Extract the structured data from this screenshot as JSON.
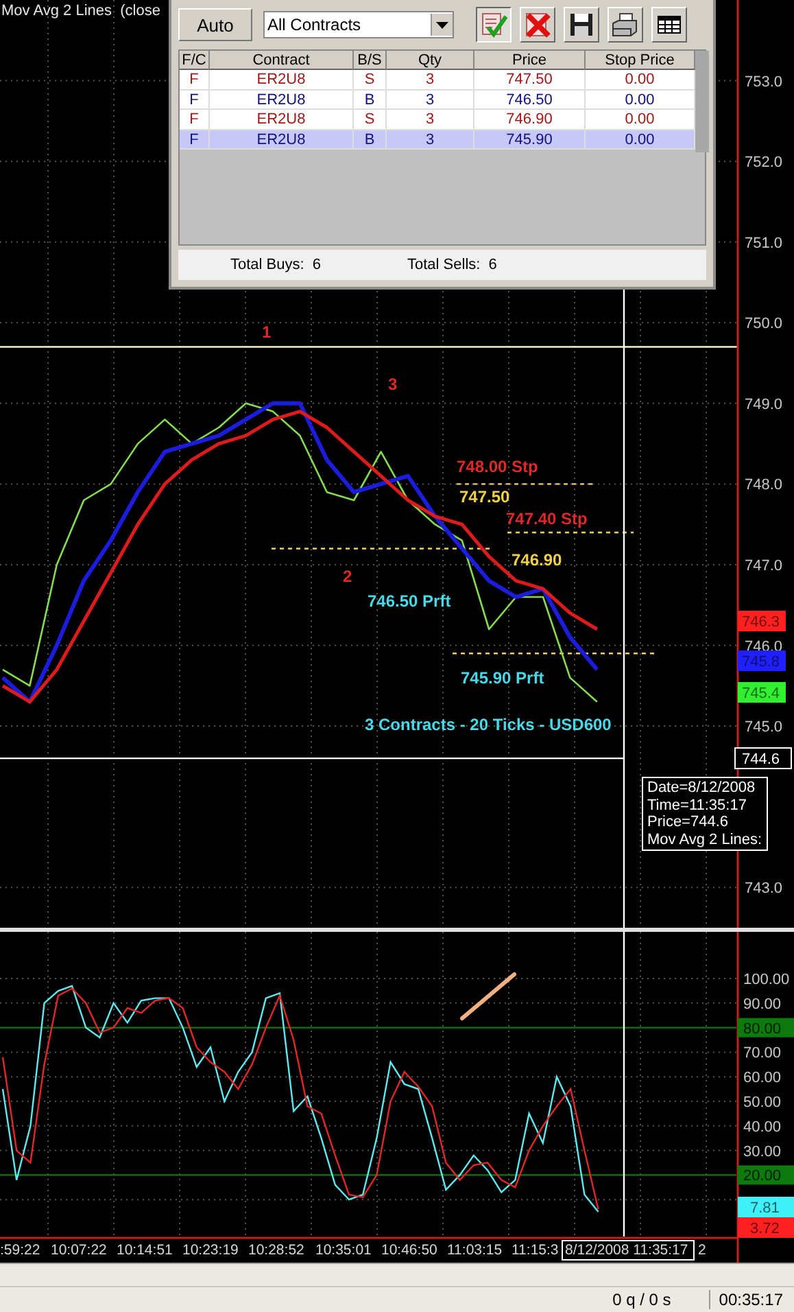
{
  "price_pane": {
    "title": "Mov Avg 2 Lines  (close",
    "chart_data": {
      "type": "line",
      "grid": true,
      "ylim": [
        742.5,
        754
      ],
      "yticks": [
        {
          "value": 753,
          "label": "753.0"
        },
        {
          "value": 752,
          "label": "752.0"
        },
        {
          "value": 751,
          "label": "751.0"
        },
        {
          "value": 750,
          "label": "750.0"
        },
        {
          "value": 749,
          "label": "749.0"
        },
        {
          "value": 748,
          "label": "748.0"
        },
        {
          "value": 747,
          "label": "747.0"
        },
        {
          "value": 746,
          "label": "746.0"
        },
        {
          "value": 745,
          "label": "745.0"
        },
        {
          "value": 743,
          "label": "743.0"
        }
      ],
      "series": [
        {
          "color": "#86dc50",
          "values": [
            745.7,
            745.5,
            747.0,
            747.8,
            748.0,
            748.5,
            748.8,
            748.5,
            748.7,
            749.0,
            748.9,
            748.6,
            747.9,
            747.8,
            748.4,
            747.8,
            747.5,
            747.3,
            746.2,
            746.6,
            746.6,
            745.6,
            745.3
          ]
        },
        {
          "color": "#1c1cdc",
          "values": [
            745.6,
            745.3,
            746.0,
            746.8,
            747.3,
            747.9,
            748.4,
            748.5,
            748.6,
            748.8,
            749.0,
            749.0,
            748.3,
            747.9,
            748.0,
            748.1,
            747.6,
            747.2,
            746.8,
            746.6,
            746.7,
            746.1,
            745.7
          ]
        },
        {
          "color": "#dc1c1c",
          "values": [
            745.5,
            745.3,
            745.7,
            746.3,
            746.9,
            747.5,
            748.0,
            748.3,
            748.5,
            748.6,
            748.8,
            748.9,
            748.7,
            748.4,
            748.1,
            747.8,
            747.6,
            747.5,
            747.1,
            746.8,
            746.7,
            746.4,
            746.2
          ]
        }
      ],
      "ref_lines": [
        {
          "axis": "y",
          "value": 749.7,
          "color": "#f4f0d0"
        },
        {
          "axis": "y",
          "value": 744.6,
          "color": "#ffffff"
        },
        {
          "axis": "y",
          "value": 748.0,
          "color": "#f0d060"
        },
        {
          "axis": "y",
          "value": 747.4,
          "color": "#f0d060"
        },
        {
          "axis": "y",
          "value": 747.2,
          "color": "#f0d060"
        },
        {
          "axis": "y",
          "value": 745.9,
          "color": "#f0d060"
        }
      ]
    },
    "annotations": [
      {
        "text": "1",
        "color": "#e02828"
      },
      {
        "text": "3",
        "color": "#e02828"
      },
      {
        "text": "2",
        "color": "#e02828"
      },
      {
        "text": "748.00 Stp",
        "color": "#e02828"
      },
      {
        "text": "747.50",
        "color": "#f0d048"
      },
      {
        "text": "747.40 Stp",
        "color": "#e02828"
      },
      {
        "text": "746.90",
        "color": "#f0d048"
      },
      {
        "text": "746.50 Prft",
        "color": "#48d8e8"
      },
      {
        "text": "745.90 Prft",
        "color": "#48d8e8"
      },
      {
        "text": "3 Contracts - 20 Ticks - USD600",
        "color": "#48d8e8"
      }
    ],
    "price_tags": [
      {
        "text": "746.3",
        "kind": "fill",
        "color": "#ff2020"
      },
      {
        "text": "745.8",
        "kind": "fill",
        "color": "#2020ff"
      },
      {
        "text": "745.4",
        "kind": "fill",
        "color": "#30f030"
      },
      {
        "text": "744.6",
        "kind": "outline",
        "color": "#ffffff"
      }
    ],
    "tooltip": [
      "Date=8/12/2008",
      "Time=11:35:17",
      "Price=744.6",
      "Mov Avg 2 Lines:"
    ]
  },
  "order_window": {
    "auto_button": "Auto",
    "filter": "All Contracts",
    "columns": [
      "F/C",
      "Contract",
      "B/S",
      "Qty",
      "Price",
      "Stop Price"
    ],
    "rows": [
      {
        "kind": "sell",
        "selected": false,
        "cells": [
          "F",
          "ER2U8",
          "S",
          "3",
          "747.50",
          "0.00"
        ]
      },
      {
        "kind": "buy",
        "selected": false,
        "cells": [
          "F",
          "ER2U8",
          "B",
          "3",
          "746.50",
          "0.00"
        ]
      },
      {
        "kind": "sell",
        "selected": false,
        "cells": [
          "F",
          "ER2U8",
          "S",
          "3",
          "746.90",
          "0.00"
        ]
      },
      {
        "kind": "buy",
        "selected": true,
        "cells": [
          "F",
          "ER2U8",
          "B",
          "3",
          "745.90",
          "0.00"
        ]
      }
    ],
    "total_buys": "Total Buys:  6",
    "total_sells": "Total Sells:  6"
  },
  "oscillator_pane": {
    "chart_data": {
      "type": "line",
      "grid": true,
      "ylim": [
        -5.6,
        119
      ],
      "yticks": [
        {
          "value": 100,
          "label": "100.00"
        },
        {
          "value": 90,
          "label": "90.00"
        },
        {
          "value": 70,
          "label": "70.00"
        },
        {
          "value": 60,
          "label": "60.00"
        },
        {
          "value": 50,
          "label": "50.00"
        },
        {
          "value": 40,
          "label": "40.00"
        },
        {
          "value": 30,
          "label": "30.00"
        }
      ],
      "series": [
        {
          "color": "#5ee8f0",
          "values": [
            55,
            18,
            40,
            90,
            95,
            97,
            80,
            76,
            90,
            82,
            91,
            92,
            92,
            80,
            64,
            72,
            50,
            62,
            70,
            92,
            94,
            46,
            52,
            35,
            16,
            10,
            12,
            35,
            66,
            57,
            55,
            35,
            14,
            20,
            28,
            22,
            13,
            18,
            45,
            33,
            60,
            48,
            12,
            5
          ]
        },
        {
          "color": "#e02828",
          "values": [
            68,
            30,
            25,
            65,
            93,
            96,
            90,
            78,
            80,
            88,
            86,
            91,
            92,
            88,
            72,
            66,
            62,
            55,
            65,
            80,
            93,
            75,
            48,
            45,
            28,
            12,
            11,
            20,
            50,
            62,
            56,
            48,
            25,
            18,
            24,
            25,
            18,
            15,
            30,
            40,
            48,
            55,
            30,
            6
          ]
        }
      ],
      "ref_lines": [
        {
          "axis": "y",
          "value": 80,
          "label": "80.00",
          "color": "#0c7a0c"
        },
        {
          "axis": "y",
          "value": 20,
          "label": "20.00",
          "color": "#0c7a0c"
        }
      ]
    },
    "value_tags": [
      {
        "text": "7.81",
        "color": "#40f0f8"
      },
      {
        "text": "3.72",
        "color": "#ff2020"
      }
    ],
    "time_axis": [
      ":59:22",
      "10:07:22",
      "10:14:51",
      "10:23:19",
      "10:28:52",
      "10:35:01",
      "10:46:50",
      "11:03:15",
      "11:15:3"
    ],
    "cursor_time": "8/12/2008 11:35:17",
    "time_axis_tail": "2"
  },
  "status_bar": {
    "queue": "0 q / 0 s",
    "clock": "00:35:17"
  }
}
